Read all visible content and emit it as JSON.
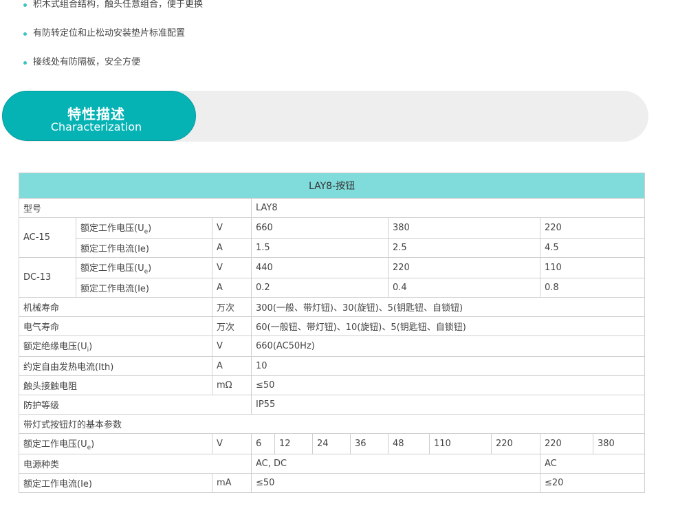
{
  "features": [
    "积木式组合结构，触头任意组合，便于更换",
    "有防转定位和止松动安装垫片标准配置",
    "接线处有防隔板，安全方便"
  ],
  "section": {
    "title": "特性描述",
    "subtitle": "Characterization"
  },
  "colors": {
    "accent": "#05b3b5",
    "header_bg": "#7fdcdb",
    "banner_bg": "#eeeeee"
  },
  "table": {
    "title": "LAY8-按钮",
    "model": {
      "label": "型号",
      "value": "LAY8"
    },
    "ac15": {
      "label": "AC-15",
      "voltage": {
        "label": "额定工作电压(U",
        "sub": "e",
        "close": ")",
        "unit": "V",
        "values": [
          "660",
          "380",
          "220"
        ]
      },
      "current": {
        "label": "额定工作电流(Ie)",
        "unit": "A",
        "values": [
          "1.5",
          "2.5",
          "4.5"
        ]
      }
    },
    "dc13": {
      "label": "DC-13",
      "voltage": {
        "label": "额定工作电压(U",
        "sub": "e",
        "close": ")",
        "unit": "V",
        "values": [
          "440",
          "220",
          "110"
        ]
      },
      "current": {
        "label": "额定工作电流(Ie)",
        "unit": "A",
        "values": [
          "0.2",
          "0.4",
          "0.8"
        ]
      }
    },
    "mech_life": {
      "label": "机械寿命",
      "unit": "万次",
      "value": "300(一般、带灯钮)、30(旋钮)、5(钥匙钮、自锁钮)"
    },
    "elec_life": {
      "label": "电气寿命",
      "unit": "万次",
      "value": "60(一般钮、带灯钮)、10(旋钮)、5(钥匙钮、自锁钮)"
    },
    "insulation": {
      "label": "额定绝缘电压(U",
      "sub": "i",
      "close": ")",
      "unit": "V",
      "value": "660(AC50Hz)"
    },
    "thermal": {
      "label": "约定自由发热电流(Ith)",
      "unit": "A",
      "value": "10"
    },
    "resistance": {
      "label": "触头接触电阻",
      "unit": "mΩ",
      "value": "≤50"
    },
    "protection": {
      "label": "防护等级",
      "value": "IP55"
    },
    "lamp_header": "带灯式按钮灯的基本参数",
    "lamp_voltage": {
      "label": "额定工作电压(U",
      "sub": "e",
      "close": ")",
      "unit": "V",
      "values": [
        "6",
        "12",
        "24",
        "36",
        "48",
        "110",
        "220",
        "220",
        "380"
      ]
    },
    "power_type": {
      "label": "电源种类",
      "value1": "AC, DC",
      "value2": "AC"
    },
    "lamp_current": {
      "label": "额定工作电流(Ie)",
      "unit": "mA",
      "value1": "≤50",
      "value2": "≤20"
    }
  }
}
